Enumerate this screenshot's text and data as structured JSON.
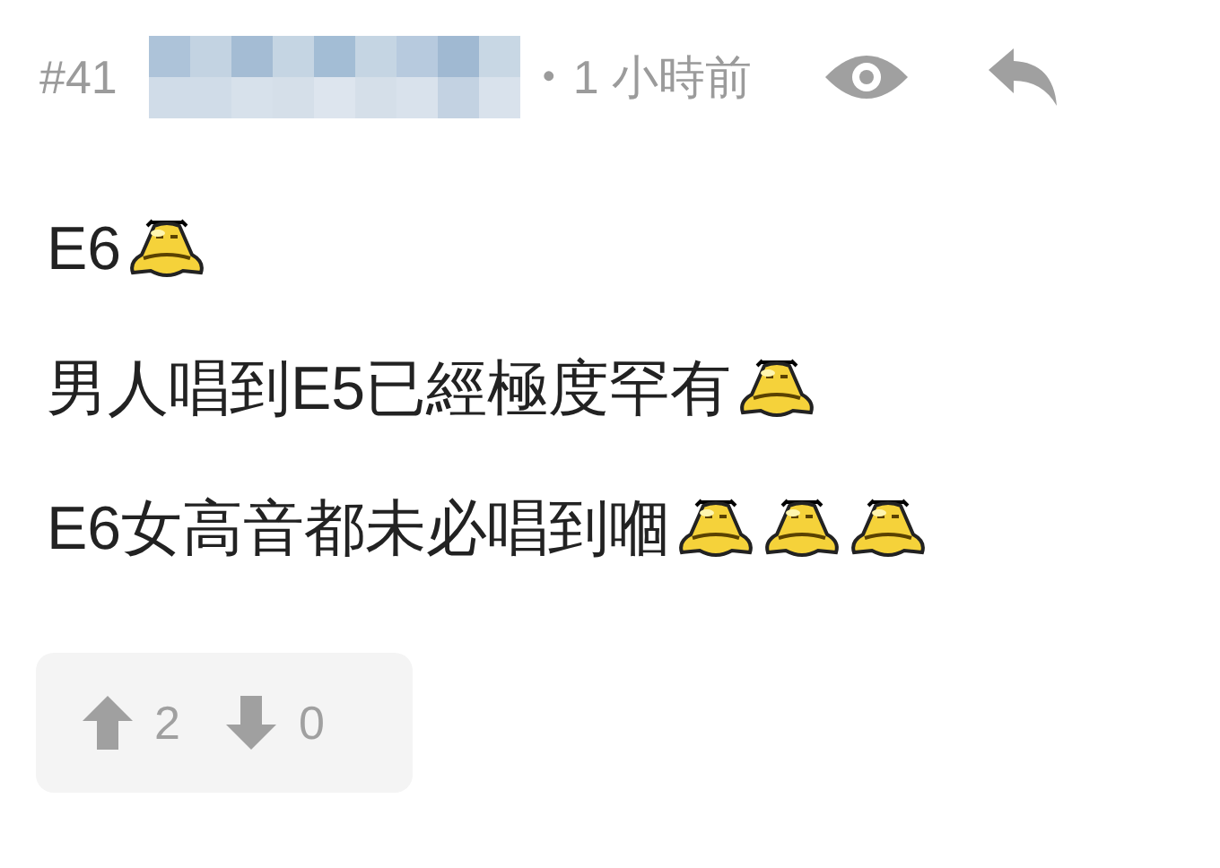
{
  "post": {
    "number": "#41",
    "author": {
      "kind": "redacted"
    },
    "separator": "•",
    "time": "1 小時前"
  },
  "lines": [
    {
      "segments": [
        {
          "kind": "text",
          "text": "E6"
        },
        {
          "kind": "emoticon"
        }
      ]
    },
    {
      "segments": [
        {
          "kind": "text",
          "text": "男人唱到E5已經極度罕有"
        },
        {
          "kind": "emoticon"
        }
      ]
    },
    {
      "segments": [
        {
          "kind": "text",
          "text": "E6女高音都未必唱到嗰"
        },
        {
          "kind": "emoticon"
        },
        {
          "kind": "emoticon"
        },
        {
          "kind": "emoticon"
        }
      ]
    }
  ],
  "votes": {
    "up": "2",
    "down": "0"
  }
}
